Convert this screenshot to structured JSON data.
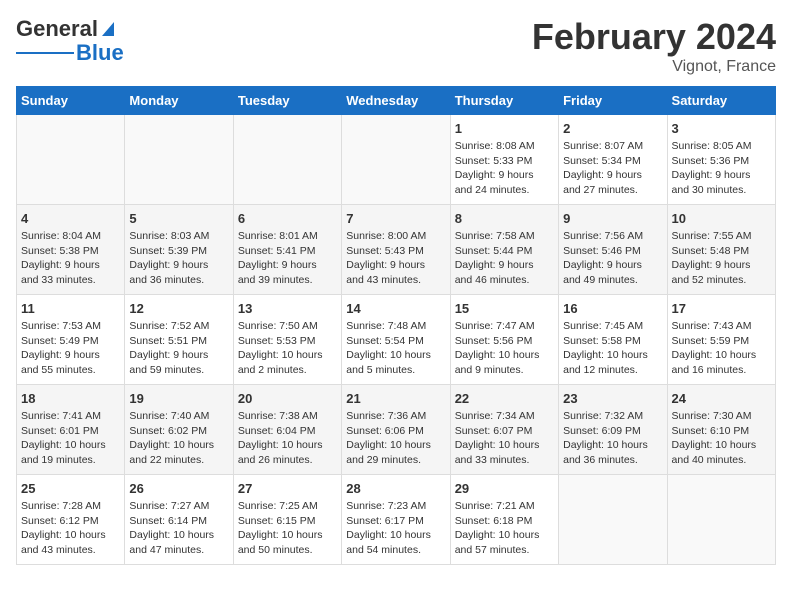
{
  "header": {
    "logo_general": "General",
    "logo_blue": "Blue",
    "month_title": "February 2024",
    "location": "Vignot, France"
  },
  "days_of_week": [
    "Sunday",
    "Monday",
    "Tuesday",
    "Wednesday",
    "Thursday",
    "Friday",
    "Saturday"
  ],
  "weeks": [
    [
      {
        "day": "",
        "info": ""
      },
      {
        "day": "",
        "info": ""
      },
      {
        "day": "",
        "info": ""
      },
      {
        "day": "",
        "info": ""
      },
      {
        "day": "1",
        "info": "Sunrise: 8:08 AM\nSunset: 5:33 PM\nDaylight: 9 hours\nand 24 minutes."
      },
      {
        "day": "2",
        "info": "Sunrise: 8:07 AM\nSunset: 5:34 PM\nDaylight: 9 hours\nand 27 minutes."
      },
      {
        "day": "3",
        "info": "Sunrise: 8:05 AM\nSunset: 5:36 PM\nDaylight: 9 hours\nand 30 minutes."
      }
    ],
    [
      {
        "day": "4",
        "info": "Sunrise: 8:04 AM\nSunset: 5:38 PM\nDaylight: 9 hours\nand 33 minutes."
      },
      {
        "day": "5",
        "info": "Sunrise: 8:03 AM\nSunset: 5:39 PM\nDaylight: 9 hours\nand 36 minutes."
      },
      {
        "day": "6",
        "info": "Sunrise: 8:01 AM\nSunset: 5:41 PM\nDaylight: 9 hours\nand 39 minutes."
      },
      {
        "day": "7",
        "info": "Sunrise: 8:00 AM\nSunset: 5:43 PM\nDaylight: 9 hours\nand 43 minutes."
      },
      {
        "day": "8",
        "info": "Sunrise: 7:58 AM\nSunset: 5:44 PM\nDaylight: 9 hours\nand 46 minutes."
      },
      {
        "day": "9",
        "info": "Sunrise: 7:56 AM\nSunset: 5:46 PM\nDaylight: 9 hours\nand 49 minutes."
      },
      {
        "day": "10",
        "info": "Sunrise: 7:55 AM\nSunset: 5:48 PM\nDaylight: 9 hours\nand 52 minutes."
      }
    ],
    [
      {
        "day": "11",
        "info": "Sunrise: 7:53 AM\nSunset: 5:49 PM\nDaylight: 9 hours\nand 55 minutes."
      },
      {
        "day": "12",
        "info": "Sunrise: 7:52 AM\nSunset: 5:51 PM\nDaylight: 9 hours\nand 59 minutes."
      },
      {
        "day": "13",
        "info": "Sunrise: 7:50 AM\nSunset: 5:53 PM\nDaylight: 10 hours\nand 2 minutes."
      },
      {
        "day": "14",
        "info": "Sunrise: 7:48 AM\nSunset: 5:54 PM\nDaylight: 10 hours\nand 5 minutes."
      },
      {
        "day": "15",
        "info": "Sunrise: 7:47 AM\nSunset: 5:56 PM\nDaylight: 10 hours\nand 9 minutes."
      },
      {
        "day": "16",
        "info": "Sunrise: 7:45 AM\nSunset: 5:58 PM\nDaylight: 10 hours\nand 12 minutes."
      },
      {
        "day": "17",
        "info": "Sunrise: 7:43 AM\nSunset: 5:59 PM\nDaylight: 10 hours\nand 16 minutes."
      }
    ],
    [
      {
        "day": "18",
        "info": "Sunrise: 7:41 AM\nSunset: 6:01 PM\nDaylight: 10 hours\nand 19 minutes."
      },
      {
        "day": "19",
        "info": "Sunrise: 7:40 AM\nSunset: 6:02 PM\nDaylight: 10 hours\nand 22 minutes."
      },
      {
        "day": "20",
        "info": "Sunrise: 7:38 AM\nSunset: 6:04 PM\nDaylight: 10 hours\nand 26 minutes."
      },
      {
        "day": "21",
        "info": "Sunrise: 7:36 AM\nSunset: 6:06 PM\nDaylight: 10 hours\nand 29 minutes."
      },
      {
        "day": "22",
        "info": "Sunrise: 7:34 AM\nSunset: 6:07 PM\nDaylight: 10 hours\nand 33 minutes."
      },
      {
        "day": "23",
        "info": "Sunrise: 7:32 AM\nSunset: 6:09 PM\nDaylight: 10 hours\nand 36 minutes."
      },
      {
        "day": "24",
        "info": "Sunrise: 7:30 AM\nSunset: 6:10 PM\nDaylight: 10 hours\nand 40 minutes."
      }
    ],
    [
      {
        "day": "25",
        "info": "Sunrise: 7:28 AM\nSunset: 6:12 PM\nDaylight: 10 hours\nand 43 minutes."
      },
      {
        "day": "26",
        "info": "Sunrise: 7:27 AM\nSunset: 6:14 PM\nDaylight: 10 hours\nand 47 minutes."
      },
      {
        "day": "27",
        "info": "Sunrise: 7:25 AM\nSunset: 6:15 PM\nDaylight: 10 hours\nand 50 minutes."
      },
      {
        "day": "28",
        "info": "Sunrise: 7:23 AM\nSunset: 6:17 PM\nDaylight: 10 hours\nand 54 minutes."
      },
      {
        "day": "29",
        "info": "Sunrise: 7:21 AM\nSunset: 6:18 PM\nDaylight: 10 hours\nand 57 minutes."
      },
      {
        "day": "",
        "info": ""
      },
      {
        "day": "",
        "info": ""
      }
    ]
  ]
}
